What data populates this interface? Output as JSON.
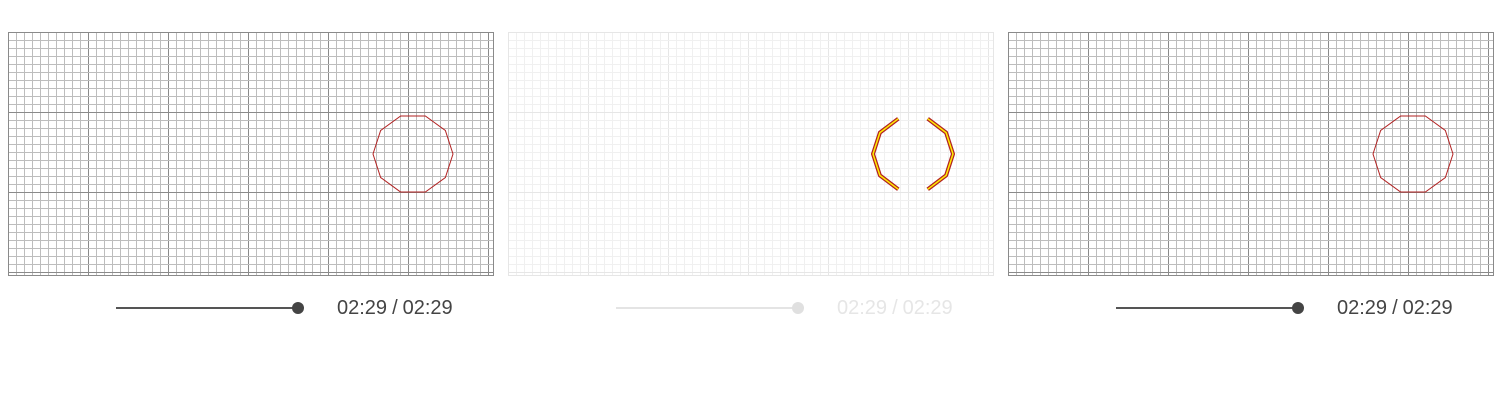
{
  "panels": [
    {
      "id": "left",
      "variant": "grid",
      "time_current": "02:29",
      "time_separator": "/",
      "time_total": "02:29",
      "playback_progress": 1.0,
      "state": "active",
      "colors": {
        "grid_minor": "#bdbdbd",
        "grid_major": "#8a8a8a",
        "shape_stroke": "#b22222"
      }
    },
    {
      "id": "middle",
      "variant": "highlight",
      "time_current": "02:29",
      "time_separator": "/",
      "time_total": "02:29",
      "playback_progress": 1.0,
      "state": "faded",
      "colors": {
        "grid_minor": "#f0f0f0",
        "grid_major": "#e6e6e6",
        "shape_stroke": "#b22222",
        "shape_highlight": "#ffee00"
      }
    },
    {
      "id": "right",
      "variant": "grid",
      "time_current": "02:29",
      "time_separator": "/",
      "time_total": "02:29",
      "playback_progress": 1.0,
      "state": "active",
      "colors": {
        "grid_minor": "#bdbdbd",
        "grid_major": "#8a8a8a",
        "shape_stroke": "#b22222"
      }
    }
  ]
}
